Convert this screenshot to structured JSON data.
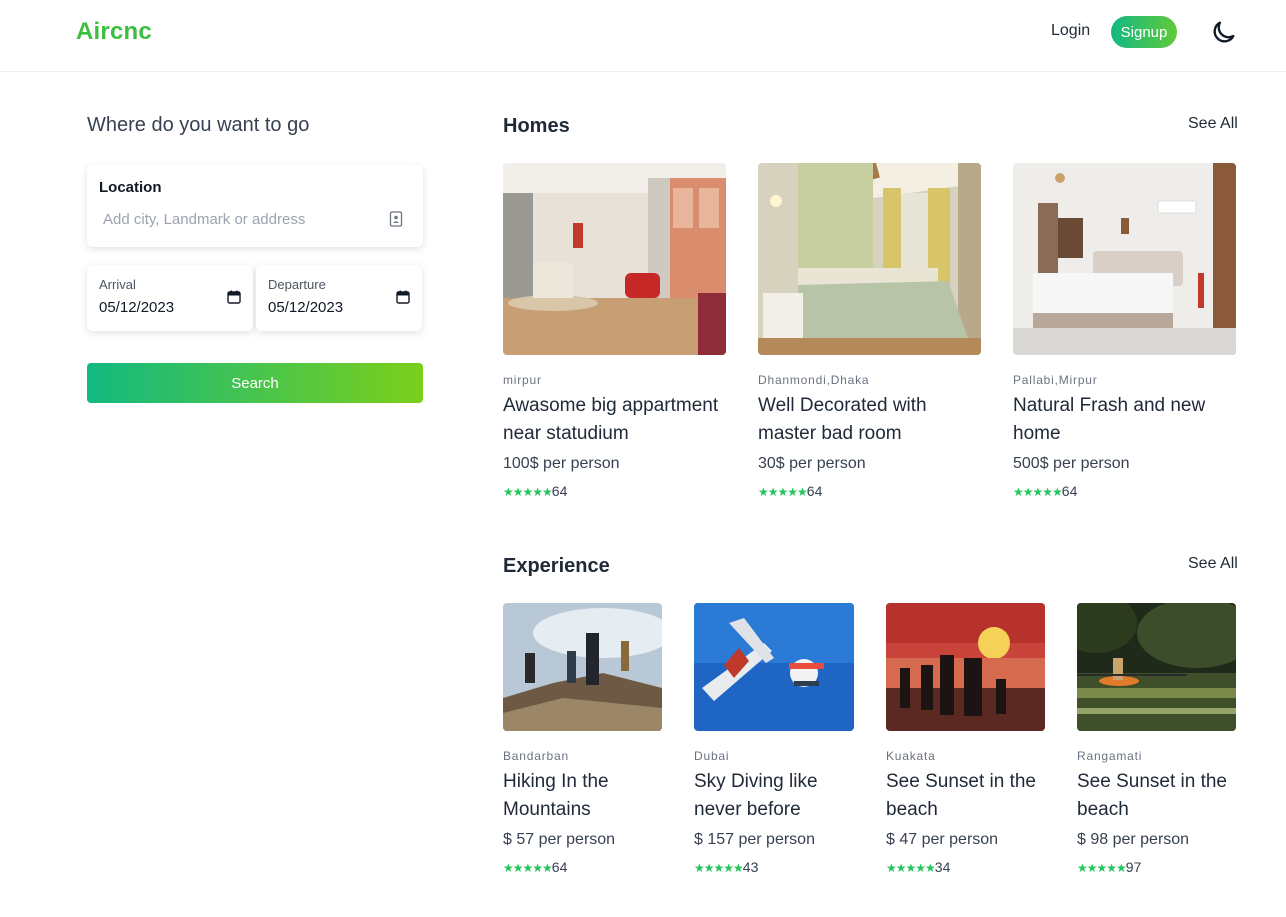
{
  "header": {
    "logo": "Aircnc",
    "login_label": "Login",
    "signup_label": "Signup",
    "theme_icon": "moon-icon"
  },
  "search": {
    "title": "Where do you want to go",
    "location_label": "Location",
    "location_placeholder": "Add city, Landmark or address",
    "location_value": "",
    "arrival_label": "Arrival",
    "arrival_value": "05/12/2023",
    "departure_label": "Departure",
    "departure_value": "05/12/2023",
    "button_label": "Search"
  },
  "homes": {
    "title": "Homes",
    "see_all": "See All",
    "items": [
      {
        "location": "mirpur",
        "name": "Awasome big appartment near statudium",
        "price": "100$ per person",
        "stars": "★★★★★",
        "rating": "64",
        "image": "living-room-photo"
      },
      {
        "location": "Dhanmondi,Dhaka",
        "name": "Well Decorated with master bad room",
        "price": "30$ per person",
        "stars": "★★★★★",
        "rating": "64",
        "image": "bedroom-photo"
      },
      {
        "location": "Pallabi,Mirpur",
        "name": "Natural Frash and new home",
        "price": "500$ per person",
        "stars": "★★★★★",
        "rating": "64",
        "image": "white-bedroom-photo"
      }
    ]
  },
  "experience": {
    "title": "Experience",
    "see_all": "See All",
    "items": [
      {
        "location": "Bandarban",
        "name": "Hiking In the Mountains",
        "price": "$ 57 per person",
        "stars": "★★★★★",
        "rating": "64",
        "image": "hikers-photo"
      },
      {
        "location": "Dubai",
        "name": "Sky Diving like never before",
        "price": "$ 157 per person",
        "stars": "★★★★★",
        "rating": "43",
        "image": "skydiving-photo"
      },
      {
        "location": "Kuakata",
        "name": "See Sunset in the beach",
        "price": "$ 47 per person",
        "stars": "★★★★★",
        "rating": "34",
        "image": "sunset-beach-photo"
      },
      {
        "location": "Rangamati",
        "name": "See Sunset in the beach",
        "price": "$ 98 per person",
        "stars": "★★★★★",
        "rating": "97",
        "image": "kayak-river-photo"
      }
    ]
  },
  "colors": {
    "brand": "#3bbf3f",
    "gradient_start": "#12b981",
    "gradient_end": "#7ccf1a",
    "star": "#22c55e"
  }
}
